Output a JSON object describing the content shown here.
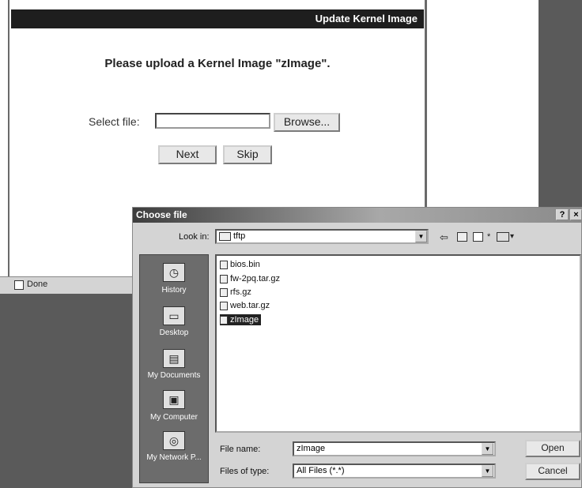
{
  "browser": {
    "header_title": "Update Kernel Image",
    "prompt": "Please upload a Kernel Image \"zImage\".",
    "select_label": "Select file:",
    "file_value": "",
    "browse_label": "Browse...",
    "next_label": "Next",
    "skip_label": "Skip",
    "status_text": "Done"
  },
  "dialog": {
    "title": "Choose file",
    "help_label": "?",
    "close_label": "×",
    "look_in_label": "Look in:",
    "look_in_value": "tftp",
    "places": [
      {
        "label": "History",
        "icon": "history-icon"
      },
      {
        "label": "Desktop",
        "icon": "desktop-icon"
      },
      {
        "label": "My Documents",
        "icon": "my-documents-icon"
      },
      {
        "label": "My Computer",
        "icon": "my-computer-icon"
      },
      {
        "label": "My Network P...",
        "icon": "network-places-icon"
      }
    ],
    "files": [
      {
        "name": "bios.bin",
        "selected": false
      },
      {
        "name": "fw-2pq.tar.gz",
        "selected": false
      },
      {
        "name": "rfs.gz",
        "selected": false
      },
      {
        "name": "web.tar.gz",
        "selected": false
      },
      {
        "name": "zImage",
        "selected": true
      }
    ],
    "file_name_label": "File name:",
    "file_name_value": "zImage",
    "files_of_type_label": "Files of type:",
    "files_of_type_value": "All Files (*.*)",
    "open_label": "Open",
    "cancel_label": "Cancel"
  }
}
